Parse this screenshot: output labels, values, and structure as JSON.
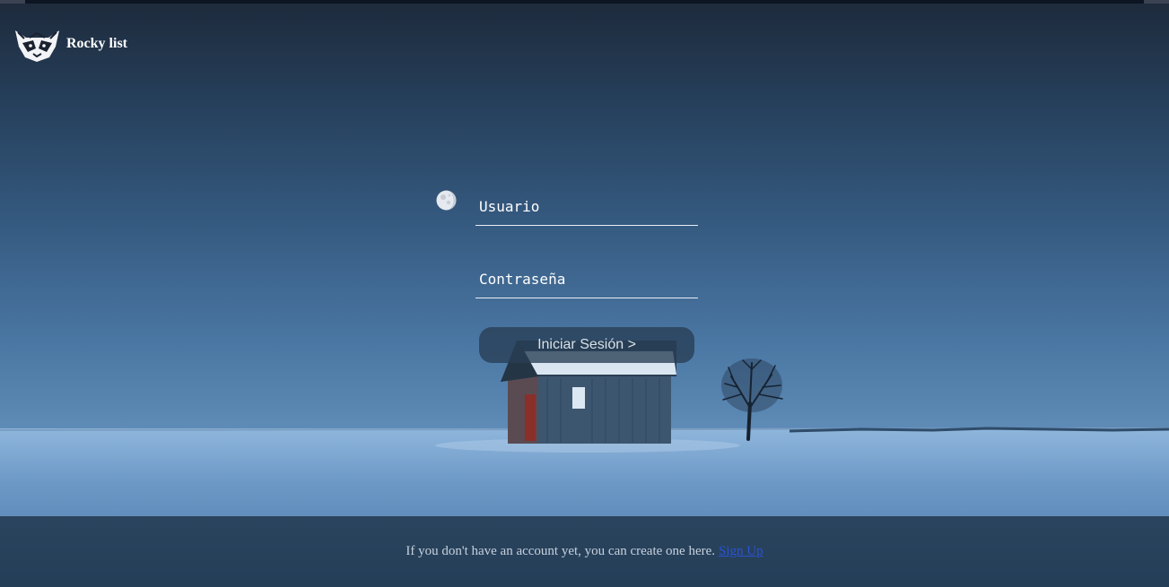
{
  "header": {
    "brand": "Rocky list",
    "logo_icon": "raccoon-logo-icon"
  },
  "form": {
    "username_placeholder": "Usuario",
    "password_placeholder": "Contraseña",
    "submit_label": "Iniciar Sesión >",
    "theme_toggle_icon": "moon-icon"
  },
  "footer": {
    "text": "If you don't have an account yet, you can create one here.",
    "link_label": "Sign Up"
  },
  "colors": {
    "sky_top": "#1d2a3b",
    "sky_mid": "#4a76a3",
    "snow": "#6e9ac6",
    "link": "#2a53d6"
  }
}
